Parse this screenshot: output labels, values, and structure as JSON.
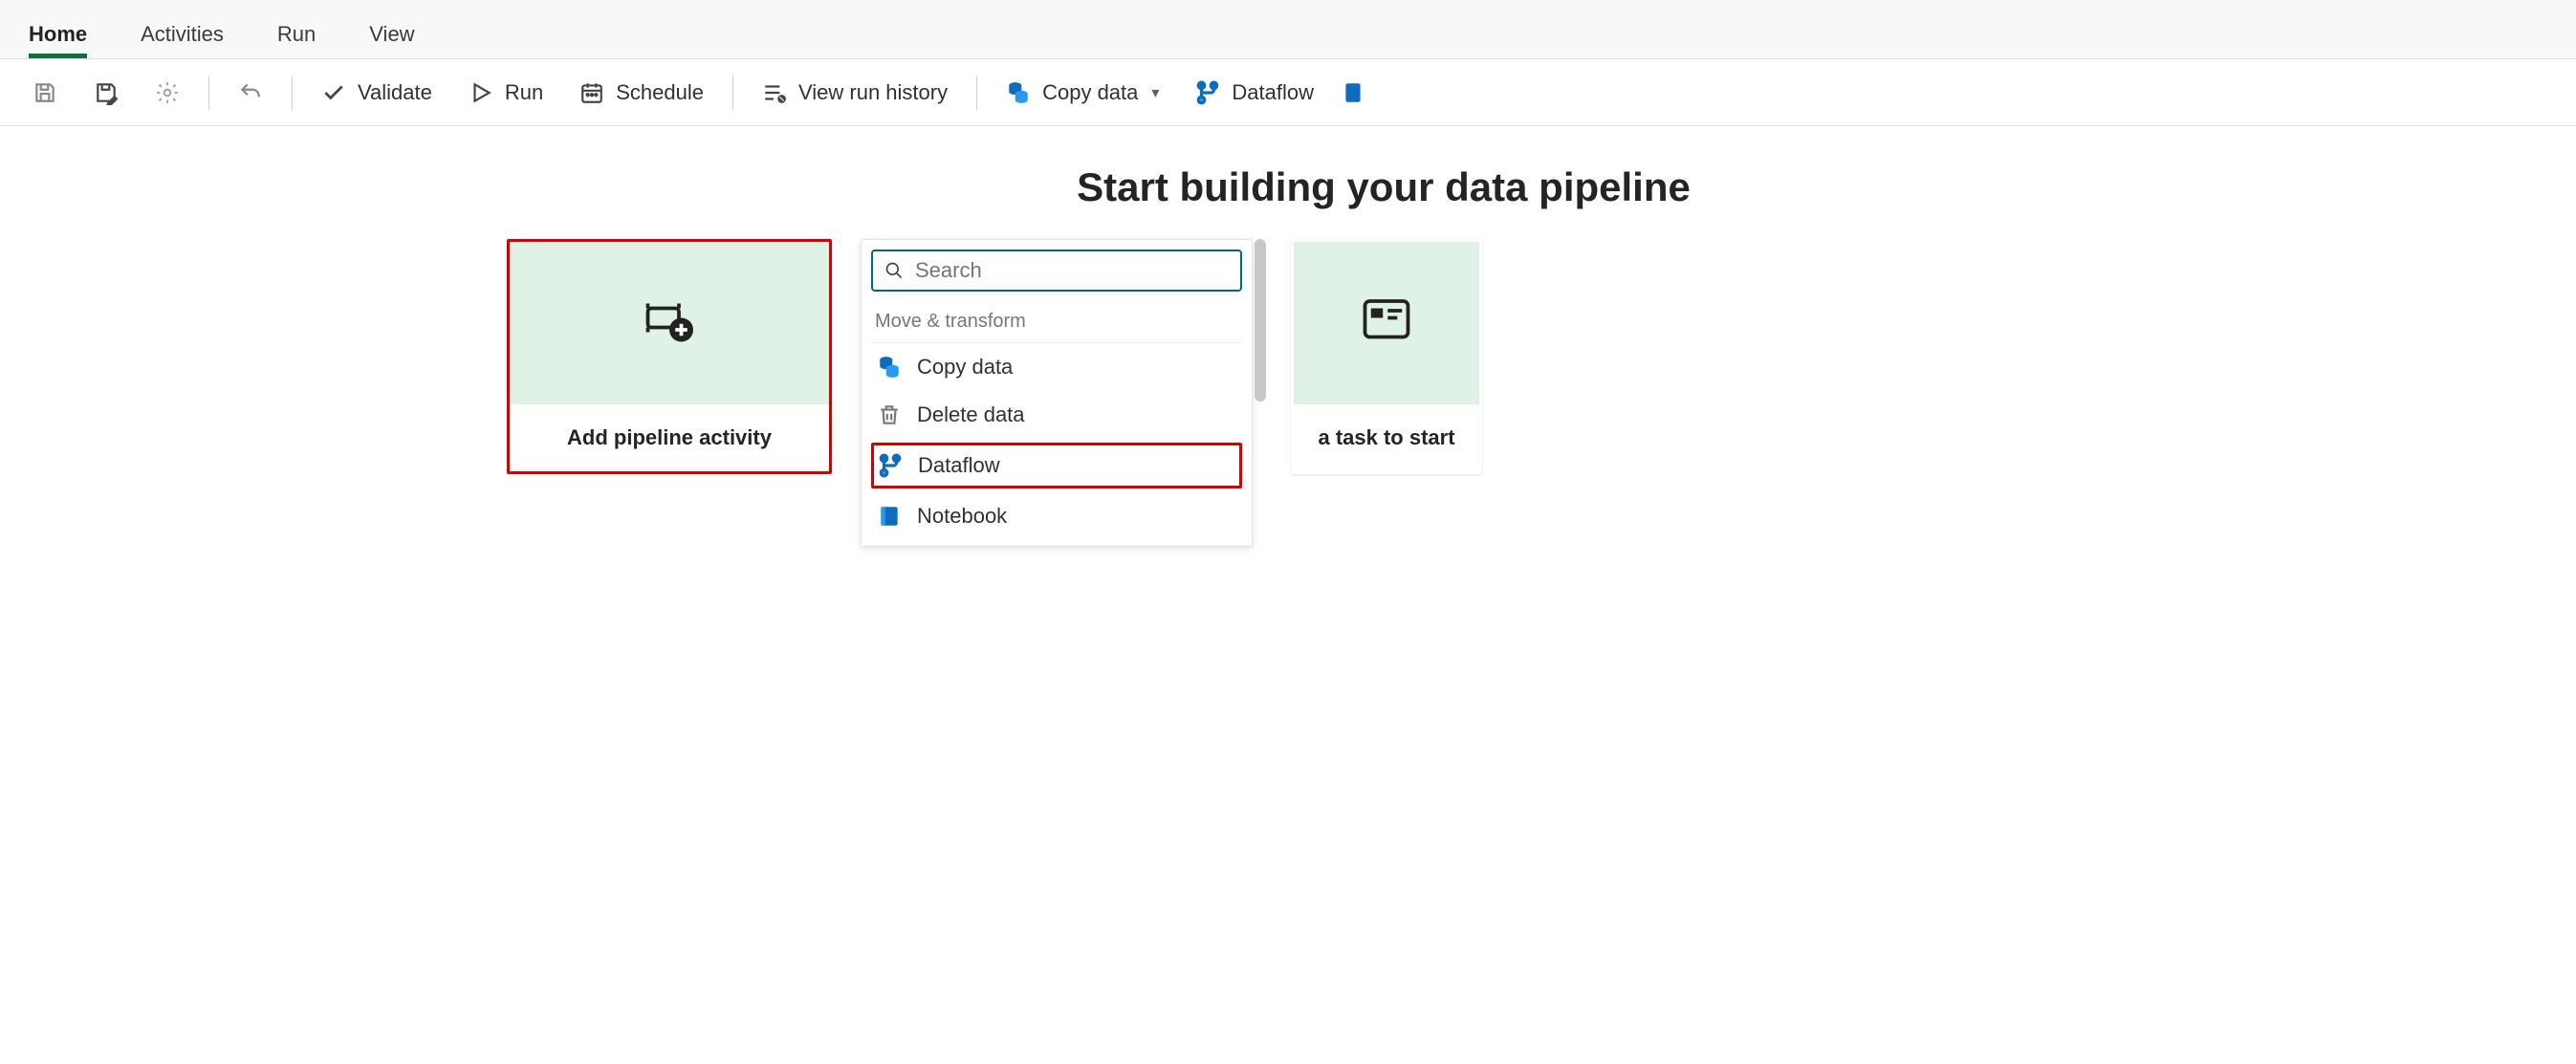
{
  "tabs": {
    "home": "Home",
    "activities": "Activities",
    "run": "Run",
    "view": "View"
  },
  "toolbar": {
    "validate": "Validate",
    "run": "Run",
    "schedule": "Schedule",
    "view_run_history": "View run history",
    "copy_data": "Copy data",
    "dataflow": "Dataflow"
  },
  "heading": "Start building your data pipeline",
  "card": {
    "add_activity": "Add pipeline activity",
    "task_start": "a task to start"
  },
  "picker": {
    "search_placeholder": "Search",
    "section_label": "Move & transform",
    "items": {
      "copy_data": "Copy data",
      "delete_data": "Delete data",
      "dataflow": "Dataflow",
      "notebook": "Notebook"
    }
  }
}
